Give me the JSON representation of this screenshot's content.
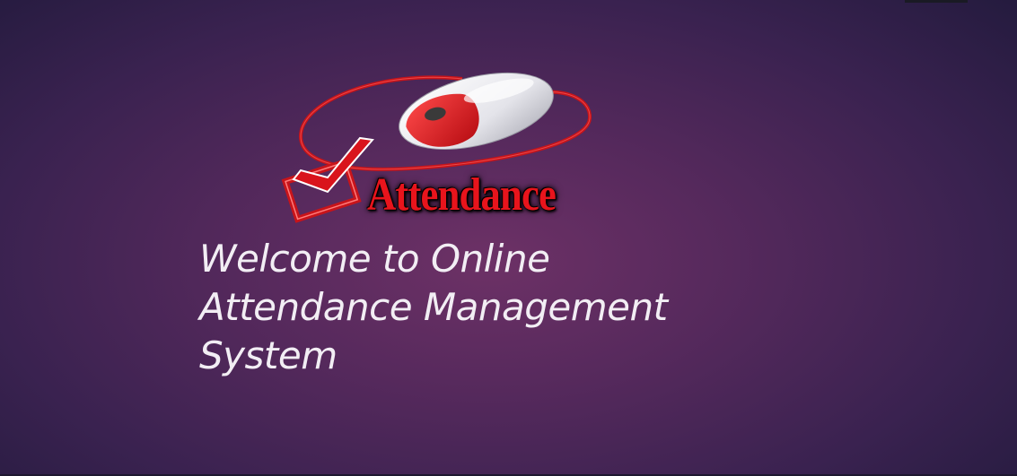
{
  "logo": {
    "text": "Attendance",
    "icon": "mouse-checkbox-icon",
    "colors": {
      "red": "#e8141c",
      "mouse_body": "#e9e9ee"
    }
  },
  "welcome": {
    "line1": "Welcome to Online",
    "line2": "Attendance Management",
    "line3": "System"
  },
  "colors": {
    "background_center": "#6d3166",
    "background_edge": "#251b3f",
    "text": "#f2eef4"
  }
}
